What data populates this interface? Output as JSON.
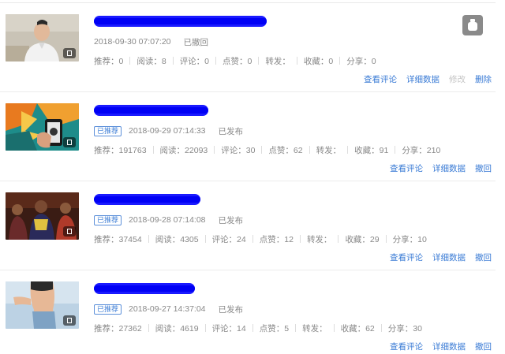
{
  "articles": [
    {
      "recommended": false,
      "badge_label": "",
      "date": "2018-09-30 07:07:20",
      "status": "已撤回",
      "stats": {
        "recommend": "推荐：0",
        "read": "阅读：8",
        "comment": "评论：0",
        "like": "点赞：0",
        "forward": "转发：",
        "collect": "收藏：0",
        "share": "分享：0"
      },
      "actions": [
        "查看评论",
        "详细数据",
        "修改",
        "删除"
      ],
      "thumb_icon": "portrait-thumbnail-icon"
    },
    {
      "recommended": true,
      "badge_label": "已推荐",
      "date": "2018-09-29 07:14:33",
      "status": "已发布",
      "stats": {
        "recommend": "推荐：191763",
        "read": "阅读：22093",
        "comment": "评论：30",
        "like": "点赞：62",
        "forward": "转发：",
        "collect": "收藏：91",
        "share": "分享：210"
      },
      "actions": [
        "查看评论",
        "详细数据",
        "撤回"
      ]
    },
    {
      "recommended": true,
      "badge_label": "已推荐",
      "date": "2018-09-28 07:14:08",
      "status": "已发布",
      "stats": {
        "recommend": "推荐：37454",
        "read": "阅读：4305",
        "comment": "评论：24",
        "like": "点赞：12",
        "forward": "转发：",
        "collect": "收藏：29",
        "share": "分享：10"
      },
      "actions": [
        "查看评论",
        "详细数据",
        "撤回"
      ]
    },
    {
      "recommended": true,
      "badge_label": "已推荐",
      "date": "2018-09-27 14:37:04",
      "status": "已发布",
      "stats": {
        "recommend": "推荐：27362",
        "read": "阅读：4619",
        "comment": "评论：14",
        "like": "点赞：5",
        "forward": "转发：",
        "collect": "收藏：62",
        "share": "分享：30"
      },
      "actions": [
        "查看评论",
        "详细数据",
        "撤回"
      ]
    }
  ],
  "colors": {
    "link": "#3a7bd5",
    "disabled": "#c4c4c4",
    "redaction": "#0000f5"
  }
}
